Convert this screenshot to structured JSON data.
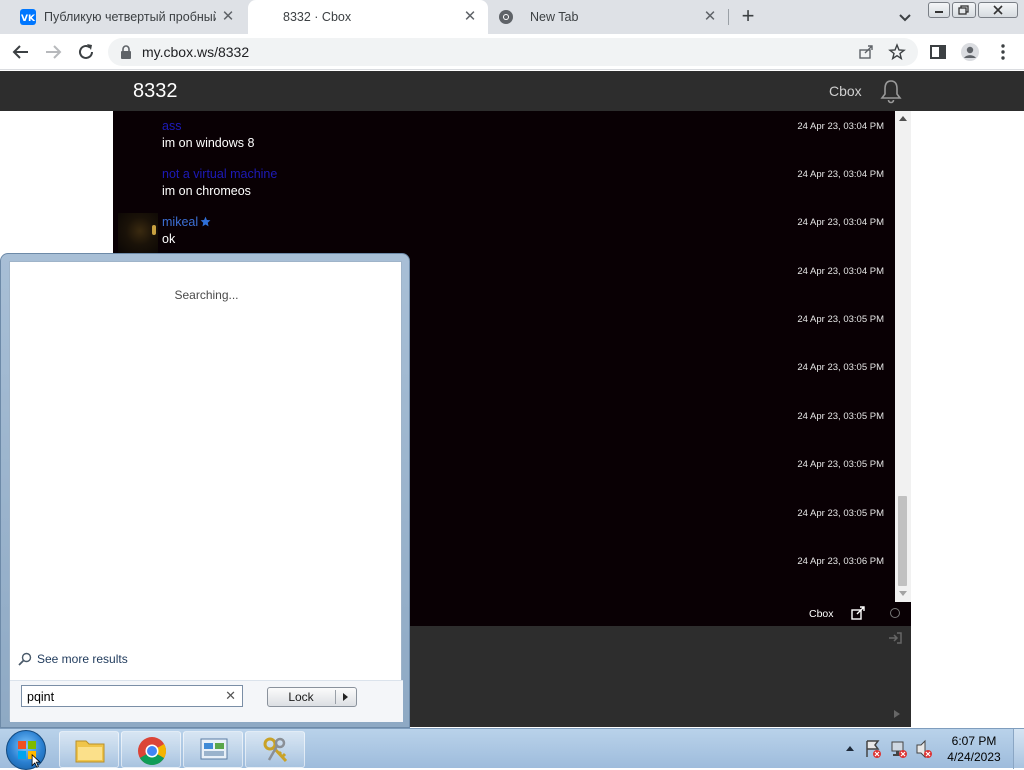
{
  "browser": {
    "tabs": [
      {
        "title": "Публикую четвертый пробный",
        "icon": "vk-icon"
      },
      {
        "title": "8332 · Cbox",
        "icon": "none"
      },
      {
        "title": "New Tab",
        "icon": "chrome-icon"
      }
    ],
    "url": "my.cbox.ws/8332"
  },
  "cbox": {
    "title": "8332",
    "brand": "Cbox",
    "messages": [
      {
        "user": "ass",
        "text": "im on windows 8",
        "time": "24 Apr 23, 03:04 PM"
      },
      {
        "user": "not a virtual machine",
        "text": "im on chromeos",
        "time": "24 Apr 23, 03:04 PM"
      },
      {
        "user": "mikeal",
        "text": "ok",
        "time": "24 Apr 23, 03:04 PM"
      },
      {
        "time": "24 Apr 23, 03:04 PM"
      },
      {
        "time": "24 Apr 23, 03:05 PM"
      },
      {
        "time": "24 Apr 23, 03:05 PM"
      },
      {
        "time": "24 Apr 23, 03:05 PM"
      },
      {
        "time": "24 Apr 23, 03:05 PM"
      },
      {
        "time": "24 Apr 23, 03:05 PM"
      },
      {
        "time": "24 Apr 23, 03:06 PM"
      }
    ],
    "footer_brand": "Cbox"
  },
  "startmenu": {
    "status": "Searching...",
    "see_more": "See more results",
    "search_value": "pqint",
    "lock_label": "Lock"
  },
  "taskbar": {
    "time": "6:07 PM",
    "date": "4/24/2023"
  }
}
